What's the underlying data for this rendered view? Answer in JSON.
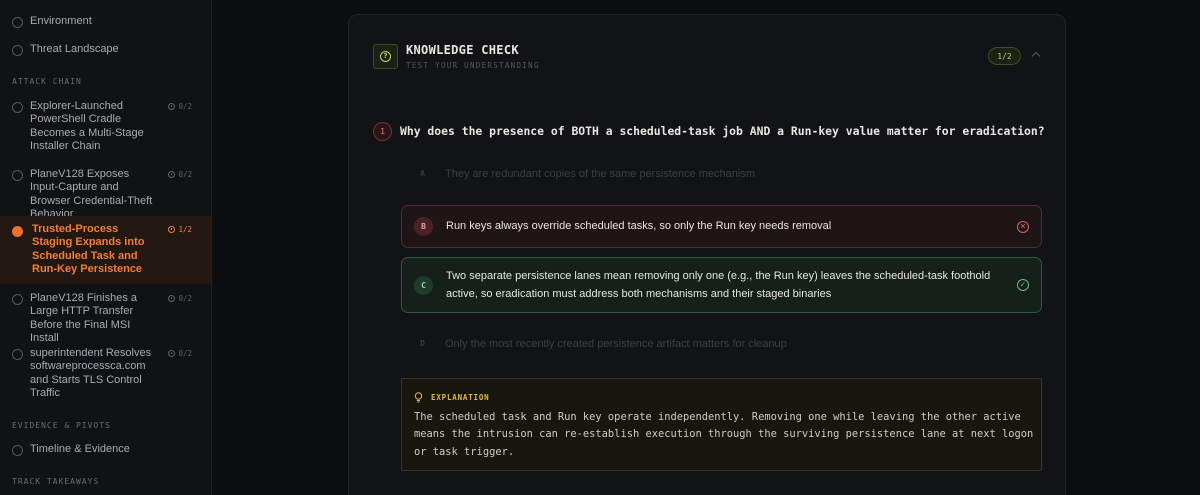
{
  "sidebar": {
    "top_items": [
      {
        "label": "Environment"
      },
      {
        "label": "Threat Landscape"
      }
    ],
    "sections": {
      "attack_chain": "ATTACK CHAIN",
      "evidence": "EVIDENCE & PIVOTS",
      "takeaways": "TRACK TAKEAWAYS"
    },
    "attack_items": [
      {
        "label": "Explorer-Launched PowerShell Cradle Becomes a Multi-Stage Installer Chain",
        "progress": "0/2"
      },
      {
        "label": "PlaneV128 Exposes Input-Capture and Browser Credential-Theft Behavior",
        "progress": "0/2"
      },
      {
        "label": "Trusted-Process Staging Expands into Scheduled Task and Run-Key Persistence",
        "progress": "1/2"
      },
      {
        "label": "PlaneV128 Finishes a Large HTTP Transfer Before the Final MSI Install",
        "progress": "0/2"
      },
      {
        "label": "superintendent Resolves softwareprocessca.com and Starts TLS Control Traffic",
        "progress": "0/2"
      }
    ],
    "evidence_items": [
      {
        "label": "Timeline & Evidence"
      }
    ]
  },
  "knowledge_check": {
    "title": "KNOWLEDGE CHECK",
    "subtitle": "TEST YOUR UNDERSTANDING",
    "badge": "1/2",
    "icon": "question-circle-icon"
  },
  "question": {
    "number": "1",
    "text": "Why does the presence of BOTH a scheduled-task job AND a Run-key value matter for eradication?",
    "options": [
      {
        "letter": "A",
        "text": "They are redundant copies of the same persistence mechanism",
        "state": "faded"
      },
      {
        "letter": "B",
        "text": "Run keys always override scheduled tasks, so only the Run key needs removal",
        "state": "wrong"
      },
      {
        "letter": "C",
        "text": "Two separate persistence lanes mean removing only one (e.g., the Run key) leaves the scheduled-task foothold active, so eradication must address both mechanisms and their staged binaries",
        "state": "correct"
      },
      {
        "letter": "D",
        "text": "Only the most recently created persistence artifact matters for cleanup",
        "state": "faded"
      }
    ]
  },
  "explanation": {
    "label": "EXPLANATION",
    "text": "The scheduled task and Run key operate independently. Removing one while leaving the other active means the intrusion can re-establish execution through the surviving persistence lane at next logon or task trigger."
  },
  "colors": {
    "accent_orange": "#ef7f3a",
    "accent_green": "#b9d46a",
    "wrong_red": "#d46666",
    "correct_green": "#6cc083",
    "explain_gold": "#e0b84a"
  }
}
